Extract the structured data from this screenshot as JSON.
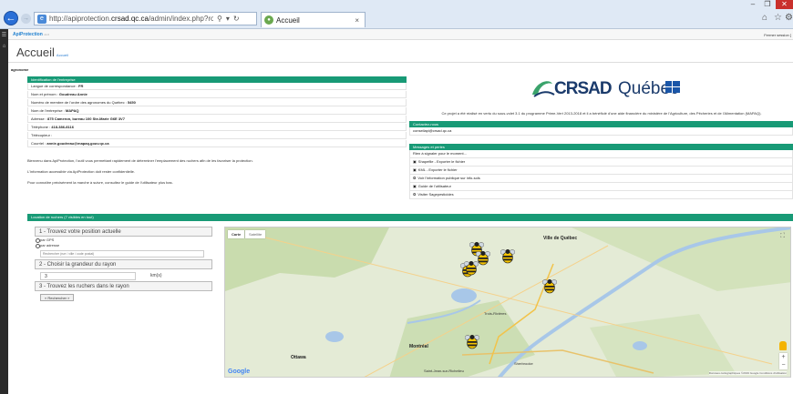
{
  "browser": {
    "url_prefix": "http://apiprotection.",
    "url_domain": "crsad.qc.ca",
    "url_rest": "/admin/index.php?route=comr",
    "tab_title": "Accueil",
    "window_buttons": {
      "minimize": "–",
      "maximize": "❐",
      "close": "✕"
    }
  },
  "app": {
    "name": "ApiProtection",
    "version": "v1.0",
    "logout": "Fermer session [",
    "page_title": "Accueil",
    "page_subtitle": "Accueil",
    "username": "agronome"
  },
  "identification": {
    "header": "Identification de l'entreprise",
    "rows": [
      {
        "label": "Langue de correspondance : ",
        "value": "FR"
      },
      {
        "label": "Nom et prénom : ",
        "value": "Goudreau Annie"
      },
      {
        "label": "Numéro de membre de l'ordre des agronomes du Québec : ",
        "value": "5450"
      },
      {
        "label": "Nom de l'entreprise : ",
        "value": "MAPAQ"
      },
      {
        "label": "Adresse : ",
        "value": "875 Cameron, bureau 100 Ste-Marie G6E 3V7"
      },
      {
        "label": "Téléphone : ",
        "value": "418-386-8116"
      },
      {
        "label": "Télécopieur : ",
        "value": ""
      },
      {
        "label": "Courriel : ",
        "value": "annie.goudreau@mapaq.gouv.qc.ca"
      }
    ]
  },
  "welcome": [
    "Bienvenu dans ApiProtection, l'outil vous permettant rapidement de déterminer l'emplacement des ruchers afin de les favoriser la protection.",
    "L'information accessible via ApiProtection doit rester confidentielle.",
    "Pour connaître précisément la marche à suivre, consultez le guide de l'utilisateur plus bas."
  ],
  "logo": {
    "crsad": "CRSAD",
    "quebec": "Québec"
  },
  "partner_text": "Ce projet a été réalisé en vertu du sous-volet 3.1 du programme Prime-Vert 2013-2018 et il a bénéficié d'une aide financière du ministère de l'Agriculture, des Pêcheries et de l'Alimentation (MAPAQ).",
  "contact": {
    "header": "Contactez-nous",
    "email": "conseilapi@crsad.qc.ca"
  },
  "messages": {
    "header": "Messages et pertes",
    "empty": "Rien à signaler pour le moment...",
    "links": [
      {
        "icon": "▣",
        "label": "Shapefile - Exporter le fichier"
      },
      {
        "icon": "▣",
        "label": "KML - Exporter le fichier"
      },
      {
        "icon": "❂",
        "label": "Voir l'information publique sur info-sols"
      },
      {
        "icon": "▣",
        "label": "Guide de l'utilisateur"
      },
      {
        "icon": "❂",
        "label": "Visiter Sagepesticides"
      }
    ]
  },
  "map_section": {
    "header": "Location de ruchers (7 visibles en tout)",
    "step1": "1 - Trouvez votre position actuelle",
    "radio_gps": "par GPS",
    "radio_address": "par adresse",
    "search_placeholder": "Rechercher (rue / ville / code postal)",
    "step2": "2 - Choisir la grandeur du rayon",
    "radius_value": "3",
    "radius_unit": "km(s)",
    "step3": "3 - Trouvez les ruchers dans le rayon",
    "search_button": "« Rechercher »"
  },
  "map": {
    "type_plan": "Carte",
    "type_satellite": "Satellite",
    "google": "Google",
    "attribution": "Données cartographiques ©2019 Google    Conditions d'utilisation",
    "places": [
      {
        "name": "Ville de Québec",
        "bold": true
      },
      {
        "name": "Montréal",
        "bold": true
      },
      {
        "name": "Ottawa",
        "bold": true
      },
      {
        "name": "Sherbrooke",
        "bold": false
      },
      {
        "name": "Trois-Rivières",
        "bold": false
      },
      {
        "name": "Saint-Jean-sur-Richelieu",
        "bold": false
      }
    ],
    "hive_count": 7
  }
}
